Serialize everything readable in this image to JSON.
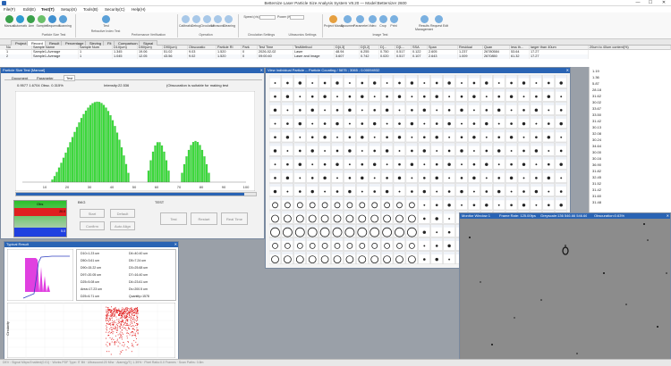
{
  "app": {
    "title": "Bettersize Laser Particle Size Analysis System V8.20 — Model:Bettersizer 2600",
    "win_min": "—",
    "win_max": "☐",
    "win_close": "✕"
  },
  "menu": [
    "File(F)",
    "Edit(E)",
    "Test(T)",
    "Setup(S)",
    "Tools(B)",
    "Security(C)",
    "Help(H)"
  ],
  "ribbon": {
    "buttons": [
      "Manual",
      "Automatic",
      "Arm",
      "Sampler",
      "Sequence",
      "Scanning",
      "Test",
      "Calibration",
      "Debug",
      "Circulation",
      "Ultrasonic",
      "Cleaning",
      "Speed (r/s)",
      "Power (W)",
      "Project Management",
      "Document",
      "Parameters",
      "Video",
      "Crop",
      "Print",
      "Results",
      "Management",
      "Request Editing"
    ],
    "groups": [
      "Particle Size Test",
      "Refractive Index Test",
      "Performance Verification",
      "Operation",
      "Circulation Settings",
      "Ultrasonics Settings",
      "Image Test"
    ]
  },
  "tabs": [
    "Project",
    "Record",
    "Result",
    "Percentage",
    "Sieving",
    "Fit",
    "Comparison",
    "Signal"
  ],
  "table": {
    "headers": [
      "No",
      "Sample Name",
      "Sample Num",
      "D10(um)",
      "D50(um)",
      "D90(um)",
      "Obscuratio",
      "Particle RI",
      "Park",
      "Test Time",
      "TestMethod",
      "D[4,3]",
      "D[3,2]",
      "D[...",
      "D[1...",
      "SSA",
      "Span",
      "Residual",
      "Quan",
      "less th...",
      "larger than 40um",
      "20um to 40um content(%)"
    ],
    "rows": [
      [
        "1",
        "Sample1-Average",
        "1",
        "1.345",
        "19.06",
        "51.02",
        "9.03",
        "1.520",
        "0",
        "2026-02-02",
        "Laser",
        "48.94",
        "6.255",
        "0.750",
        "0.517",
        "0.122",
        "2.605",
        "1.237",
        "26780584",
        "53.64",
        "17.27",
        ""
      ],
      [
        "2",
        "Sample1-Average",
        "1",
        "1.045",
        "12.05",
        "43.56",
        "9.02",
        "1.520",
        "0",
        "09:00:40",
        "Laser and Image",
        "3.607",
        "0.742",
        "0.020",
        "0.517",
        "0.107",
        "2.643",
        "1.009",
        "2670850",
        "61.32",
        "17.27",
        ""
      ]
    ]
  },
  "right_values": [
    "1.19",
    "1.36",
    "5.87",
    "28.18",
    "31.62",
    "30.02",
    "33.67",
    "33.50",
    "31.42",
    "30.13",
    "32.08",
    "30.24",
    "34.64",
    "30.00",
    "30.16",
    "36.90",
    "31.82",
    "32.45",
    "31.52",
    "31.42",
    "31.60",
    "31.48"
  ],
  "size_test": {
    "title": "Particle Size Test [Manual]",
    "subtabs": [
      "Document",
      "Parameter",
      "Test"
    ],
    "obsc_info": "0.9577   1.6704   Obsc. 0.315%",
    "intensity": "Intensity:22.536",
    "message": "(Obscuration is suitable for making test",
    "obs_label": "Obs",
    "obs_top": "20.0",
    "obs_bottom": "5.0",
    "bkg_label": "BKG",
    "test_label": "TEST",
    "bkg_buttons": [
      "Start",
      "Default",
      "Confirm",
      "Auto Align"
    ],
    "test_buttons": [
      "Test",
      "Restart",
      "Real Time"
    ],
    "axis_ticks": [
      "10",
      "20",
      "30",
      "40",
      "50",
      "60",
      "70",
      "80",
      "90",
      "100"
    ]
  },
  "typical": {
    "title": "Typical Result",
    "stats_left": [
      "D10=1.23 um",
      "D50=3.61 um",
      "D90=15.22 um",
      "D97=20.05 um",
      "D25=5.08 um",
      "Area=17.23 um",
      "D25=6.71 um"
    ],
    "stats_right": [
      "D4=40.40 um",
      "D5=7.24 um",
      "D3=25.68 um",
      "D7=16.40 um",
      "D4=23.61 um",
      "Dv=200.5 um",
      "Quantity=1578"
    ],
    "scatter_xlabel": "Particle Size(um)",
    "scatter_ylabel": "Circularity"
  },
  "counting": {
    "title": "View Individual Particle -- Particle Counting / 5875 ; 3065 ; 0.00094932"
  },
  "monitor": {
    "title": "Monitor Window 1",
    "frame_rate": "Frame Rate: 125.00fps",
    "grayscale": "Greyscale:136 546.66 546.66",
    "obscuration": "Obscuration:0.63%"
  },
  "status": "DEV : Signal Mbps:Enabled(0.01) · Works.PDF Type: IT Bit · Ultrasound:20 Mhz · Alarm(g/T:) 1.39% · Pixel Ratio:0.0 Frames · Scan Paths: 0.8m"
}
